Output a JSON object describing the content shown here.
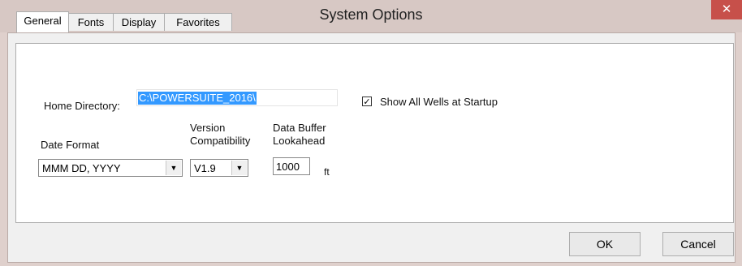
{
  "window": {
    "title": "System Options",
    "close_glyph": "✕"
  },
  "tabs": [
    {
      "label": "General",
      "active": true
    },
    {
      "label": "Fonts",
      "active": false
    },
    {
      "label": "Display",
      "active": false
    },
    {
      "label": "Favorites",
      "active": false
    }
  ],
  "general": {
    "home_directory_label": "Home Directory:",
    "home_directory_value": "C:\\POWERSUITE_2016\\",
    "show_all_wells_label": "Show All Wells at Startup",
    "show_all_wells_checked": true,
    "check_glyph": "✓",
    "date_format_label": "Date Format",
    "date_format_value": "MMM DD, YYYY",
    "version_label_line1": "Version",
    "version_label_line2": "Compatibility",
    "version_value": "V1.9",
    "buffer_label_line1": "Data Buffer",
    "buffer_label_line2": "Lookahead",
    "buffer_value": "1000",
    "buffer_unit": "ft",
    "dropdown_glyph": "▼"
  },
  "buttons": {
    "ok": "OK",
    "cancel": "Cancel"
  },
  "colors": {
    "selection": "#3399ff",
    "close": "#c7504a"
  }
}
